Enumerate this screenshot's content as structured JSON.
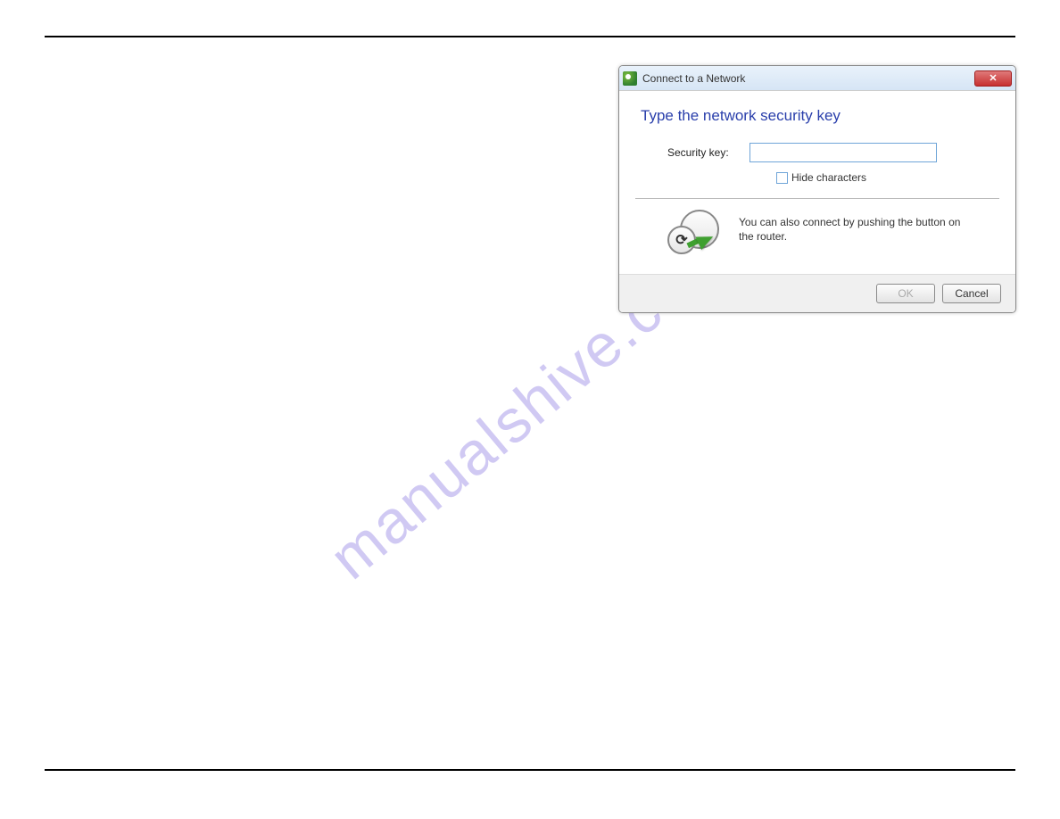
{
  "watermark": "manualshive.com",
  "dialog": {
    "title": "Connect to a Network",
    "close": "✕",
    "heading": "Type the network security key",
    "security_key_label": "Security key:",
    "security_key_value": "",
    "hide_label": "Hide characters",
    "hint": "You can also connect by pushing the button on the router.",
    "ok_label": "OK",
    "cancel_label": "Cancel"
  }
}
